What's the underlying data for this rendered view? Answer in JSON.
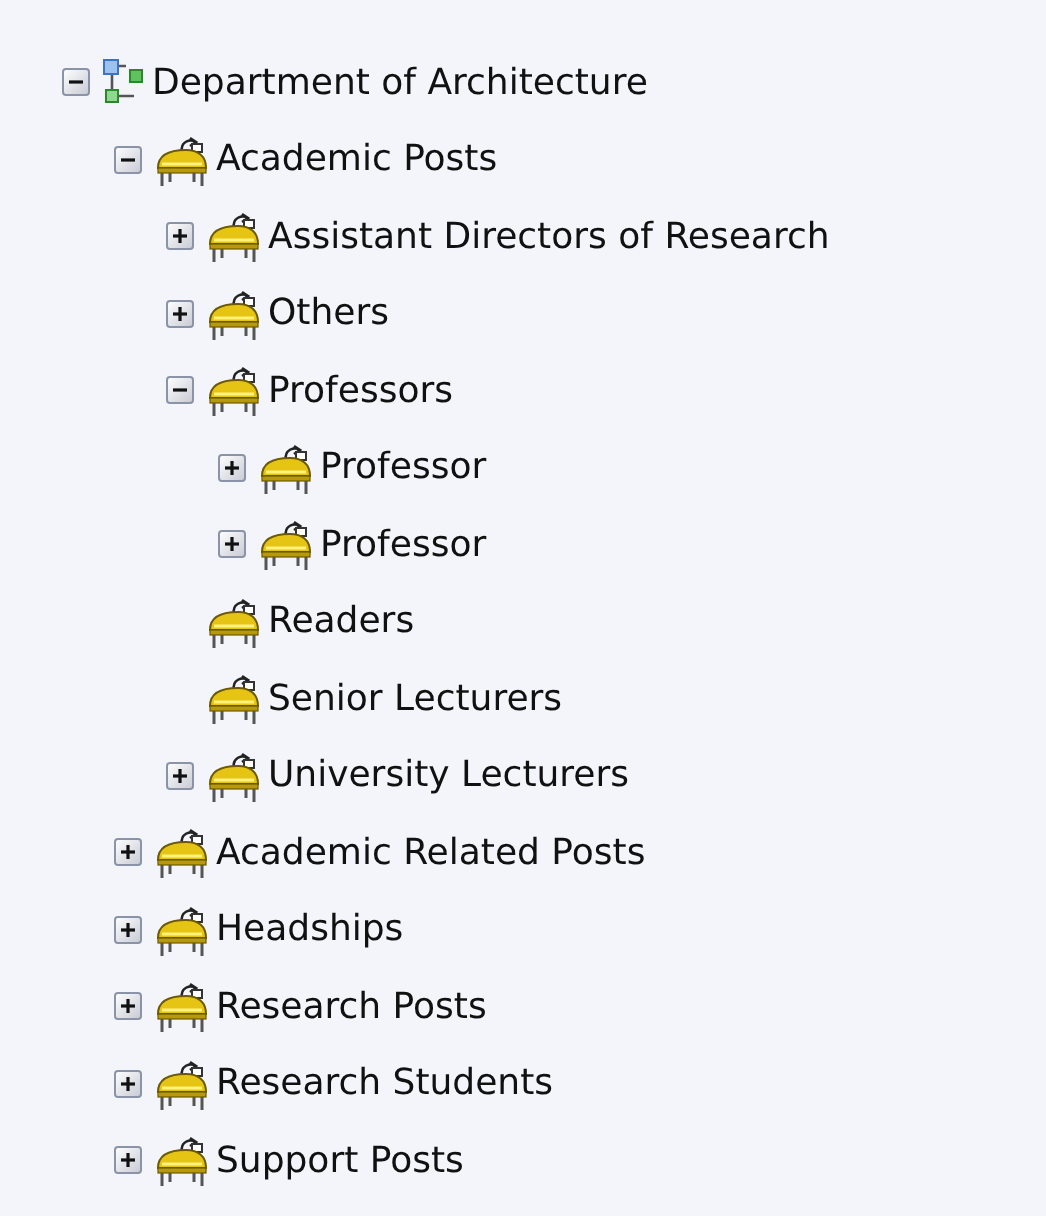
{
  "tree": [
    {
      "label": "Department of Architecture",
      "kind": "root",
      "expanded": true,
      "children": [
        {
          "label": "Academic Posts",
          "kind": "post",
          "expanded": true,
          "children": [
            {
              "label": "Assistant Directors of Research",
              "kind": "post",
              "expanded": false
            },
            {
              "label": "Others",
              "kind": "post",
              "expanded": false
            },
            {
              "label": "Professors",
              "kind": "post",
              "expanded": true,
              "children": [
                {
                  "label": "Professor",
                  "kind": "post",
                  "expanded": false
                },
                {
                  "label": "Professor",
                  "kind": "post",
                  "expanded": false
                }
              ]
            },
            {
              "label": "Readers",
              "kind": "post"
            },
            {
              "label": "Senior Lecturers",
              "kind": "post"
            },
            {
              "label": "University Lecturers",
              "kind": "post",
              "expanded": false
            }
          ]
        },
        {
          "label": "Academic Related Posts",
          "kind": "post",
          "expanded": false
        },
        {
          "label": "Headships",
          "kind": "post",
          "expanded": false
        },
        {
          "label": "Research Posts",
          "kind": "post",
          "expanded": false
        },
        {
          "label": "Research Students",
          "kind": "post",
          "expanded": false
        },
        {
          "label": "Support Posts",
          "kind": "post",
          "expanded": false
        }
      ]
    }
  ]
}
